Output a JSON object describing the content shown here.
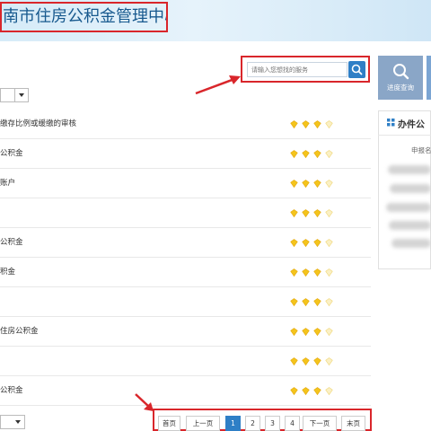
{
  "header": {
    "title": "南市住房公积金管理中心"
  },
  "search": {
    "placeholder": "请输入您想找的服务"
  },
  "list": {
    "rows": [
      {
        "label": "缴存比例或缓缴的审核",
        "rating": 3
      },
      {
        "label": "公积金",
        "rating": 3
      },
      {
        "label": "账户",
        "rating": 3
      },
      {
        "label": "",
        "rating": 3
      },
      {
        "label": "公积金",
        "rating": 3
      },
      {
        "label": "积金",
        "rating": 3
      },
      {
        "label": "",
        "rating": 3
      },
      {
        "label": "住房公积金",
        "rating": 3
      },
      {
        "label": "",
        "rating": 3
      },
      {
        "label": "公积金",
        "rating": 3
      }
    ],
    "rating_max": 4
  },
  "right_panel": {
    "progress_label": "进度查询",
    "panel_title": "办件公",
    "panel_sub": "申报名"
  },
  "pagination": {
    "first": "首页",
    "prev": "上一页",
    "pages": [
      "1",
      "2",
      "3",
      "4"
    ],
    "current": "1",
    "next": "下一页",
    "last": "末页"
  },
  "colors": {
    "highlight_border": "#d9262b",
    "accent_blue": "#2f7fc6",
    "star_fill": "#f4c41c",
    "title_blue": "#17598e"
  }
}
